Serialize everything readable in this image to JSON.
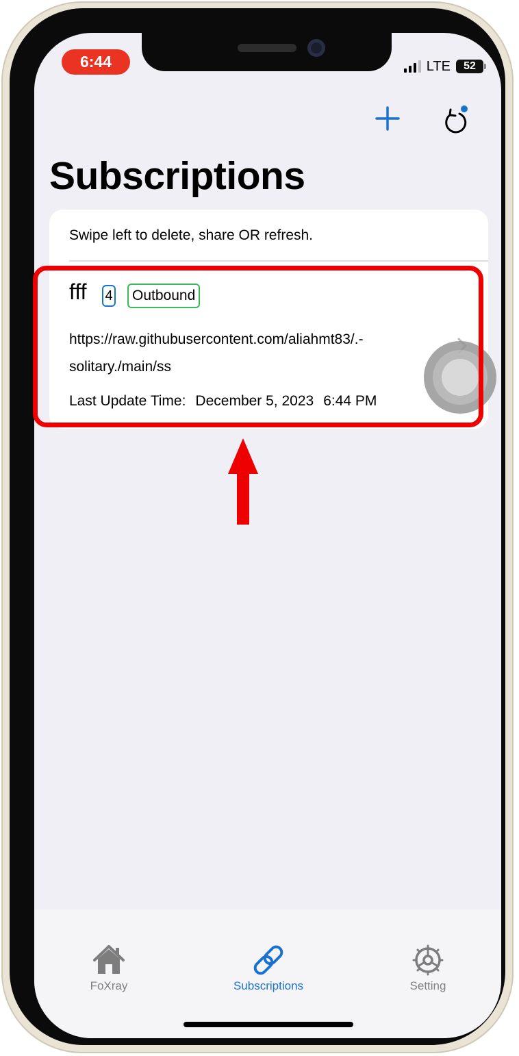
{
  "status_bar": {
    "time": "6:44",
    "network": "LTE",
    "battery": "52"
  },
  "nav": {
    "add_icon": "plus-icon",
    "refresh_icon": "refresh-icon",
    "refresh_has_badge": true
  },
  "page": {
    "title": "Subscriptions"
  },
  "list": {
    "hint": "Swipe left to delete, share OR refresh.",
    "items": [
      {
        "name": "fff",
        "count": "4",
        "type": "Outbound",
        "url": "https://raw.githubusercontent.com/aliahmt83/.-solitary./main/ss",
        "last_update_label": "Last Update Time:",
        "last_update_date": "December 5, 2023",
        "last_update_time": "6:44 PM"
      }
    ]
  },
  "tabs": [
    {
      "label": "FoXray",
      "icon": "house-icon",
      "active": false
    },
    {
      "label": "Subscriptions",
      "icon": "link-icon",
      "active": true
    },
    {
      "label": "Setting",
      "icon": "gear-icon",
      "active": false
    }
  ],
  "colors": {
    "accent": "#1a72cf",
    "highlight": "#ee0000",
    "badge_blue": "#1476d3",
    "badge_green": "#3cba5a",
    "time_pill": "#ea3323"
  }
}
